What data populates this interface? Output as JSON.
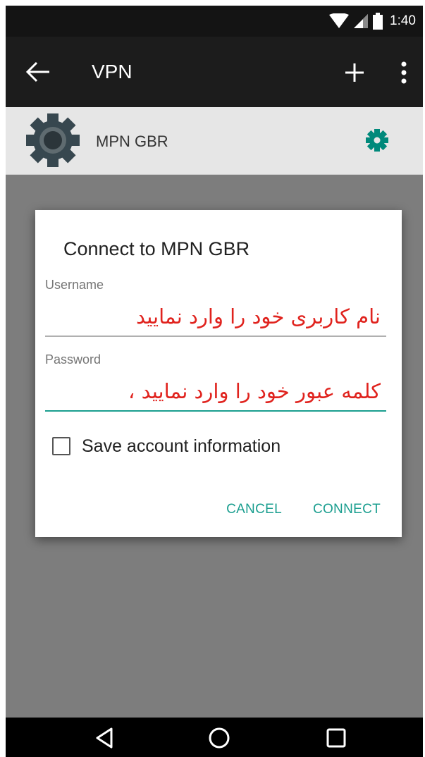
{
  "status_bar": {
    "time": "1:40",
    "icons": [
      "wifi-icon",
      "cell-signal-icon",
      "battery-icon"
    ]
  },
  "app_bar": {
    "title": "VPN",
    "icons": [
      "back-arrow-icon",
      "plus-icon",
      "more-vert-icon"
    ]
  },
  "vpn_list": {
    "items": [
      {
        "name": "MPN GBR",
        "icon": "vpn-gear-icon",
        "action_icon": "settings-icon"
      }
    ]
  },
  "dialog": {
    "title": "Connect to MPN GBR",
    "username": {
      "label": "Username",
      "value": "",
      "placeholder": "نام کاربری خود را وارد نمایید"
    },
    "password": {
      "label": "Password",
      "value": "",
      "placeholder": "کلمه عبور خود را وارد نمایید ،"
    },
    "save_account": {
      "label": "Save account information",
      "checked": false
    },
    "cancel_label": "CANCEL",
    "connect_label": "CONNECT"
  },
  "nav_bar": {
    "icons": [
      "nav-back-icon",
      "nav-home-icon",
      "nav-recents-icon"
    ]
  },
  "colors": {
    "accent": "#1a9e8f",
    "hint_text": "#e0231e",
    "app_bar": "#1c1c1c",
    "status_bar": "#141414",
    "scrim": "#7d7d7d"
  }
}
